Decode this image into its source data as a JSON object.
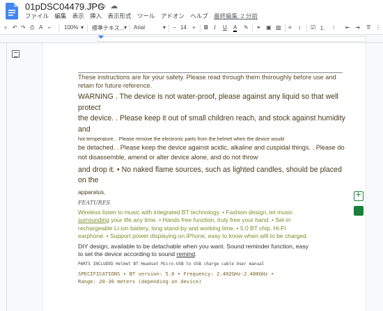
{
  "title": {
    "doc_name": "01pDSC04479.JPG",
    "icons": [
      "star-icon",
      "move-to-folder-icon",
      "cloud-status-icon"
    ]
  },
  "menu": {
    "items": [
      "ファイル",
      "編集",
      "表示",
      "挿入",
      "表示形式",
      "ツール",
      "アドオン",
      "ヘルプ"
    ],
    "last_edit": "最終編集: 2 分前"
  },
  "toolbar": {
    "zoom": "100%",
    "style": "標準テキス...",
    "font": "Arial",
    "font_size": "14"
  },
  "doc": {
    "p_intro": "These instructions are for your safety. Please read through them thoroughly before use and retain for future reference.",
    "p_warning": "WARNING . The device is not water-proof, please against any liquid so that well protect",
    "p_keep": "the device. . Please keep it out of small children reach, and stock against humidity and",
    "p_hot": "hot temperature. . Please remove the electronic parts from the helmet when the device would",
    "p_detached": "be detached. . Please keep the device against acidic, alkaline and cuspidal things. . Please do not disassemble, amend or alter device alone, and do not throw",
    "p_drop": "and drop it. • No naked flame sources, such as lighted candles, should be placed on the",
    "p_apparatus": "apparatus.",
    "p_features": "FEATURES",
    "f1": "Wireless listen to music with integrated BT technology. • Fashion design, let music",
    "f2_u": "surrounding",
    "f2_rest": " your life any time. • Hands free function, truly free your hand. • Set-in",
    "f3": "rechargeable Li-ion battery, long stand-by and working time. • 5.0 BT chip, Hi-Fi",
    "f4": "earphone. • Support power displaying on iPhone, easy to know when will to be charged.",
    "diy1": "DIY design, available to be detachable when you want. Sound reminder function, easy",
    "diy2": "to set the device according to sound ",
    "diy2_u": "remind",
    "diy2_end": ".",
    "parts": "PARTS INCLUDED Helmet BT Headset Micro-USB to USB charge cable User manual",
    "spec1": "SPECIFICATIONS • BT version: 5.0 • Frequency: 2.402GHz-2.480GHz •",
    "spec2": "Range: 20-30 meters (depending on device)"
  },
  "side_panel": {
    "buttons": [
      "add-comment-icon",
      "suggest-edits-icon"
    ]
  }
}
